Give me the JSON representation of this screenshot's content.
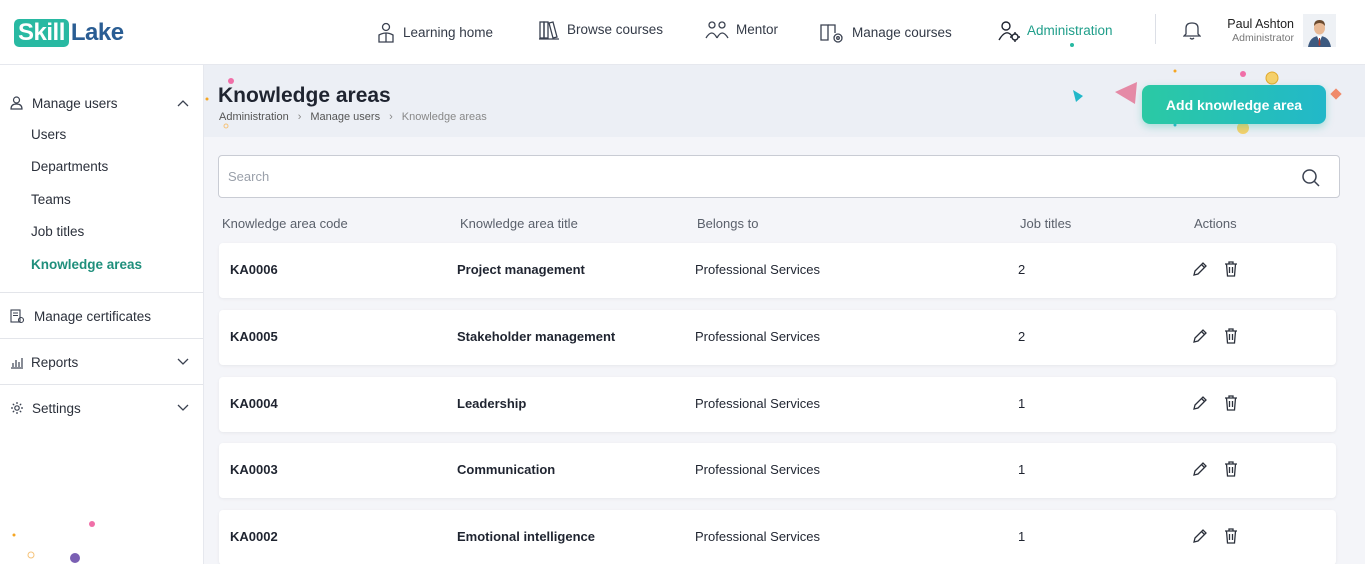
{
  "brand": {
    "logo_part1": "Skill",
    "logo_part2": "Lake"
  },
  "nav": [
    {
      "label": "Learning home",
      "icon": "learning-home-icon"
    },
    {
      "label": "Browse courses",
      "icon": "books-icon"
    },
    {
      "label": "Mentor",
      "icon": "mentor-icon"
    },
    {
      "label": "Manage courses",
      "icon": "manage-courses-icon"
    },
    {
      "label": "Administration",
      "icon": "admin-icon",
      "active": true
    }
  ],
  "user": {
    "name": "Paul Ashton",
    "role": "Administrator"
  },
  "sidebar": {
    "manage_users": {
      "label": "Manage users",
      "items": [
        "Users",
        "Departments",
        "Teams",
        "Job titles",
        "Knowledge areas"
      ],
      "active": "Knowledge areas"
    },
    "manage_certificates": "Manage certificates",
    "reports": "Reports",
    "settings": "Settings"
  },
  "page": {
    "title": "Knowledge areas",
    "breadcrumb": [
      "Administration",
      "Manage users",
      "Knowledge areas"
    ],
    "add_button": "Add knowledge area"
  },
  "search": {
    "placeholder": "Search"
  },
  "table": {
    "headers": [
      "Knowledge area code",
      "Knowledge area title",
      "Belongs to",
      "Job titles",
      "Actions"
    ],
    "rows": [
      {
        "code": "KA0006",
        "title": "Project management",
        "belongs_to": "Professional Services",
        "job_titles": "2"
      },
      {
        "code": "KA0005",
        "title": "Stakeholder management",
        "belongs_to": "Professional Services",
        "job_titles": "2"
      },
      {
        "code": "KA0004",
        "title": "Leadership",
        "belongs_to": "Professional Services",
        "job_titles": "1"
      },
      {
        "code": "KA0003",
        "title": "Communication",
        "belongs_to": "Professional Services",
        "job_titles": "1"
      },
      {
        "code": "KA0002",
        "title": "Emotional intelligence",
        "belongs_to": "Professional Services",
        "job_titles": "1"
      }
    ]
  },
  "colors": {
    "accent": "#28b9a2",
    "brand_blue": "#2a5d93",
    "active_text": "#1f8f7c"
  }
}
